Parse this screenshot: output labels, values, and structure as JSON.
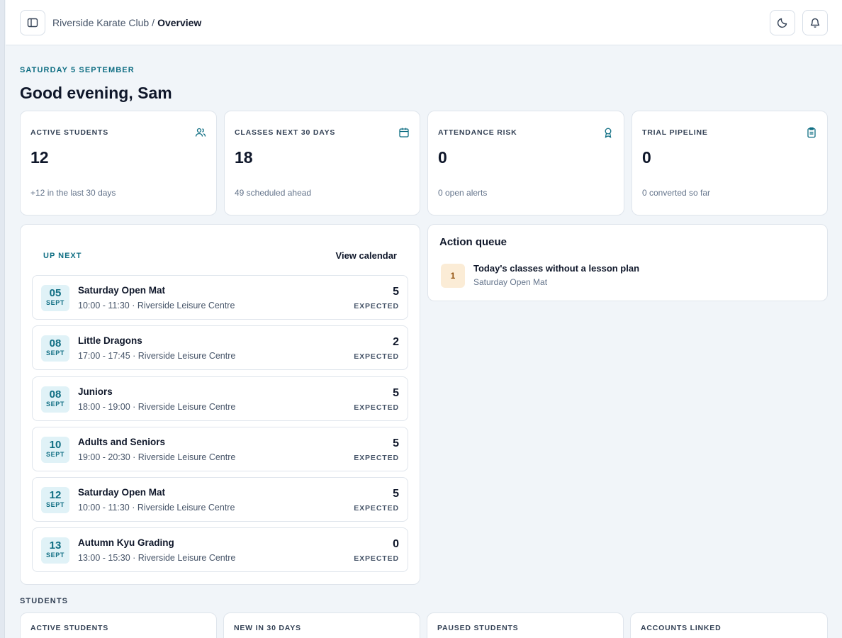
{
  "header": {
    "breadcrumb_parent": "Riverside Karate Club",
    "breadcrumb_sep": "/",
    "breadcrumb_current": "Overview",
    "icons": [
      "sidebar-toggle-icon",
      "moon-icon",
      "bell-icon"
    ]
  },
  "date": "SATURDAY 5 SEPTEMBER",
  "greeting": "Good evening, Sam",
  "stats": [
    {
      "label": "ACTIVE STUDENTS",
      "value": "12",
      "sub": "+12 in the last 30 days",
      "icon": "users-icon"
    },
    {
      "label": "CLASSES NEXT 30 DAYS",
      "value": "18",
      "sub": "49 scheduled ahead",
      "icon": "calendar-icon"
    },
    {
      "label": "ATTENDANCE RISK",
      "value": "0",
      "sub": "0 open alerts",
      "icon": "award-icon"
    },
    {
      "label": "TRIAL PIPELINE",
      "value": "0",
      "sub": "0 converted so far",
      "icon": "clipboard-icon"
    }
  ],
  "up_next": {
    "title": "UP NEXT",
    "view_calendar": "View calendar",
    "events": [
      {
        "day": "05",
        "month": "SEPT",
        "name": "Saturday Open Mat",
        "meta": "10:00 - 11:30 · Riverside Leisure Centre",
        "count": "5",
        "expected": "EXPECTED"
      },
      {
        "day": "08",
        "month": "SEPT",
        "name": "Little Dragons",
        "meta": "17:00 - 17:45 · Riverside Leisure Centre",
        "count": "2",
        "expected": "EXPECTED"
      },
      {
        "day": "08",
        "month": "SEPT",
        "name": "Juniors",
        "meta": "18:00 - 19:00 · Riverside Leisure Centre",
        "count": "5",
        "expected": "EXPECTED"
      },
      {
        "day": "10",
        "month": "SEPT",
        "name": "Adults and Seniors",
        "meta": "19:00 - 20:30 · Riverside Leisure Centre",
        "count": "5",
        "expected": "EXPECTED"
      },
      {
        "day": "12",
        "month": "SEPT",
        "name": "Saturday Open Mat",
        "meta": "10:00 - 11:30 · Riverside Leisure Centre",
        "count": "5",
        "expected": "EXPECTED"
      },
      {
        "day": "13",
        "month": "SEPT",
        "name": "Autumn Kyu Grading",
        "meta": "13:00 - 15:30 · Riverside Leisure Centre",
        "count": "0",
        "expected": "EXPECTED"
      }
    ]
  },
  "action_queue": {
    "title": "Action queue",
    "items": [
      {
        "badge": "1",
        "title": "Today's classes without a lesson plan",
        "sub": "Saturday Open Mat"
      }
    ]
  },
  "students": {
    "heading": "STUDENTS",
    "cards": [
      "ACTIVE STUDENTS",
      "NEW IN 30 DAYS",
      "PAUSED STUDENTS",
      "ACCOUNTS LINKED"
    ]
  },
  "colors": {
    "accent": "#0f6e83",
    "accent_bg": "#e0f2f7",
    "warning_bg": "#fbecd6",
    "page_bg": "#f1f5f9"
  }
}
